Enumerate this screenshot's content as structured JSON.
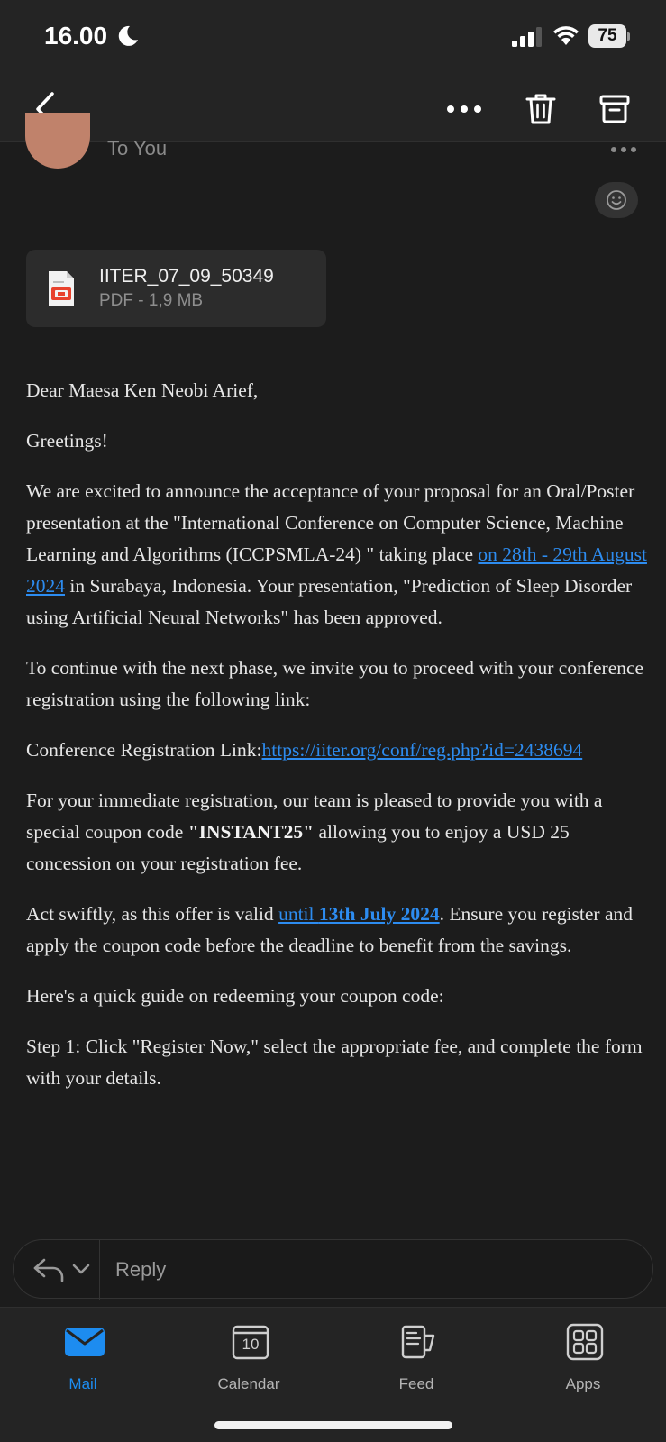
{
  "status_bar": {
    "time": "16.00",
    "battery": "75"
  },
  "toolbar": {
    "icons": [
      "chevron-left-icon",
      "more-horizontal-icon",
      "trash-icon",
      "archive-icon"
    ]
  },
  "sender": {
    "to_label": "To You"
  },
  "attachment": {
    "name": "IITER_07_09_50349",
    "meta": "PDF - 1,9 MB"
  },
  "email": {
    "greeting": "Dear Maesa Ken Neobi Arief,",
    "greetings": "Greetings!",
    "p1_a": "We are excited to announce the acceptance of your proposal for an Oral/Poster presentation at the \"International Conference on Computer Science, Machine Learning and Algorithms (ICCPSMLA-24) \" taking place ",
    "p1_link": "on 28th - 29th August 2024",
    "p1_b": " in Surabaya, Indonesia. Your presentation, \"Prediction of Sleep Disorder using Artificial Neural Networks\" has been approved.",
    "p2": "To continue with the next phase, we invite you to proceed with your conference registration using the following link:",
    "p3_label": "Conference Registration Link:",
    "p3_link": "https://iiter.org/conf/reg.php?id=2438694",
    "p4_a": "For your immediate registration, our team is pleased to provide you with a special coupon code ",
    "p4_code": "\"INSTANT25\"",
    "p4_b": " allowing you to enjoy a USD 25 concession on your registration fee.",
    "p5_a": "Act swiftly, as this offer is valid ",
    "p5_link_a": "until ",
    "p5_link_b": "13th July 2024",
    "p5_b": ". Ensure you register and apply the coupon code before the deadline to benefit from the savings.",
    "p6": "Here's a quick guide on redeeming your coupon code:",
    "p7": "Step 1: Click \"Register Now,\" select the appropriate fee, and complete the form with your details."
  },
  "reply": {
    "label": "Reply"
  },
  "tabs": [
    {
      "label": "Mail",
      "icon": "mail-icon",
      "active": true
    },
    {
      "label": "Calendar",
      "icon": "calendar-icon",
      "badge": "10"
    },
    {
      "label": "Feed",
      "icon": "feed-icon"
    },
    {
      "label": "Apps",
      "icon": "apps-grid-icon"
    }
  ],
  "colors": {
    "accent": "#1d8cf0",
    "background": "#1c1c1c",
    "link": "#2d8cf0"
  }
}
